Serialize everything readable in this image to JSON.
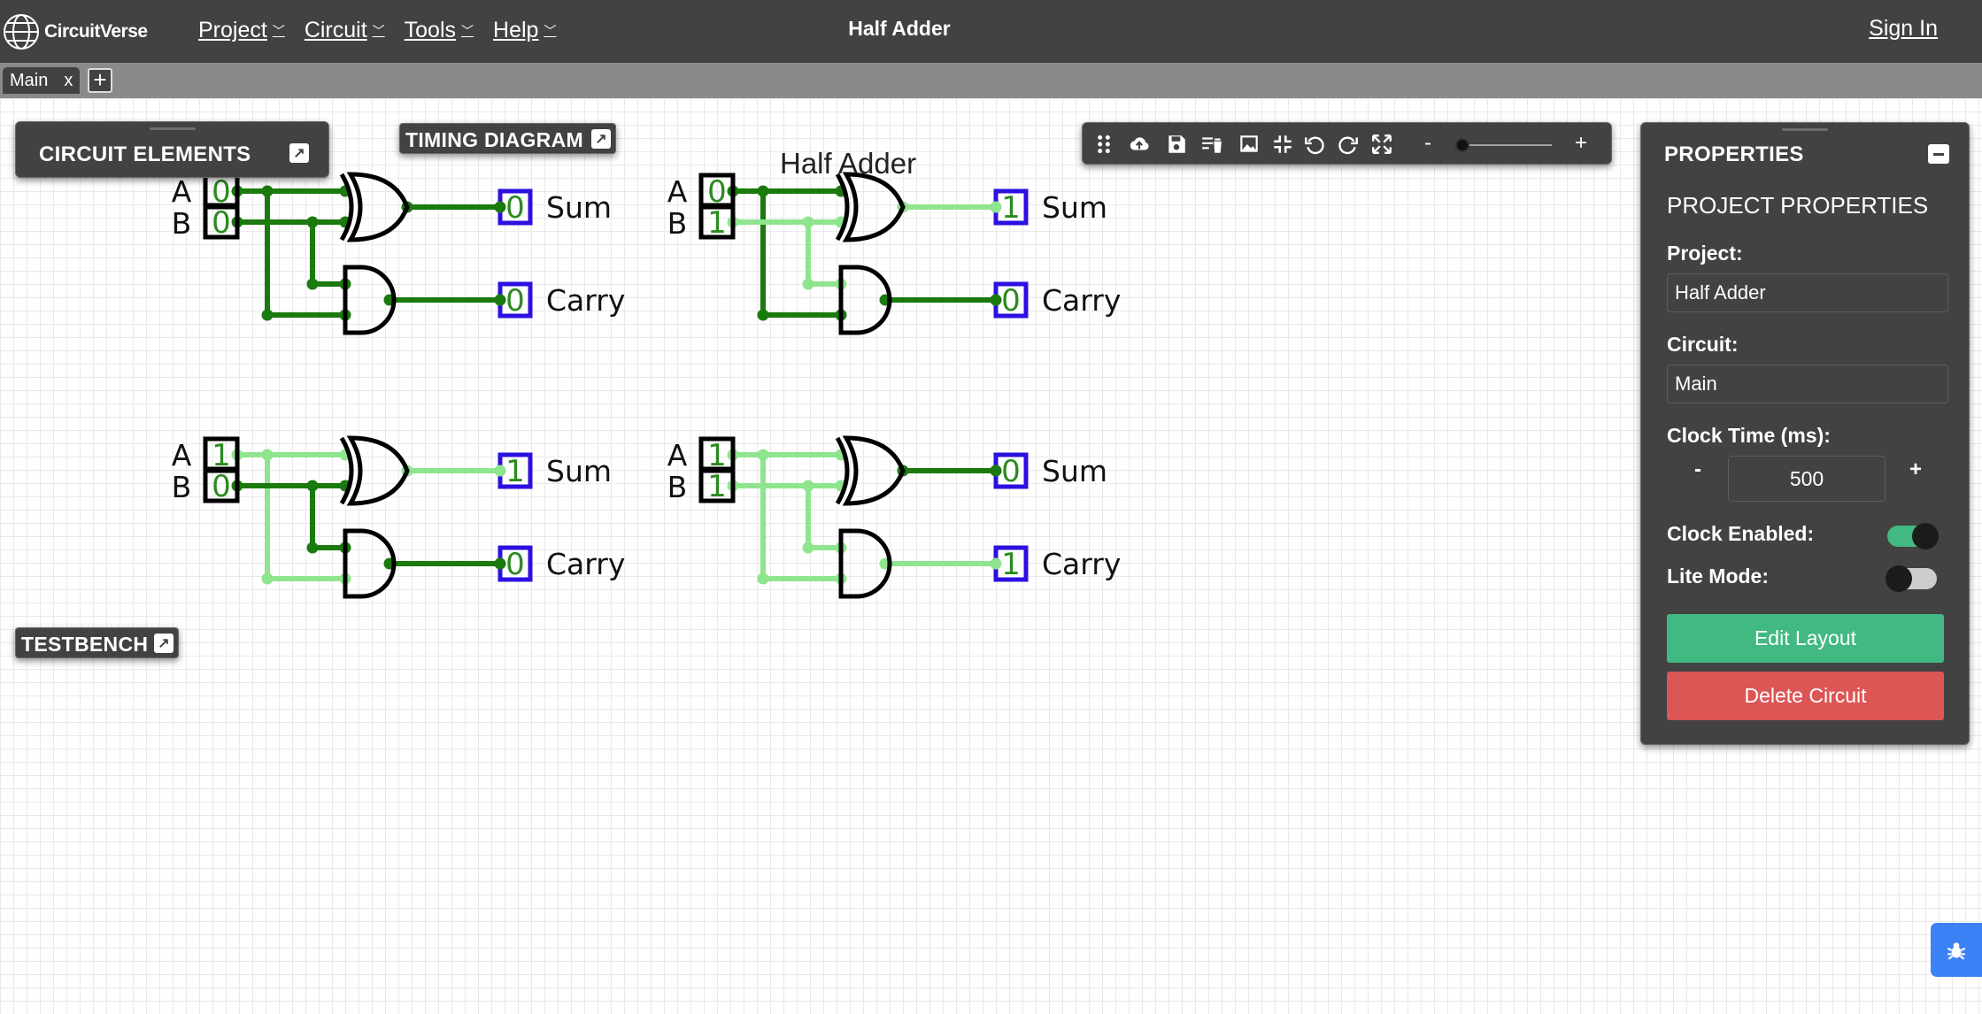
{
  "navbar": {
    "logo_text": "CircuitVerse",
    "menu": [
      {
        "label": "Project"
      },
      {
        "label": "Circuit"
      },
      {
        "label": "Tools"
      },
      {
        "label": "Help"
      }
    ],
    "title": "Half Adder",
    "signin": "Sign In"
  },
  "tabs": {
    "active_tab": "Main",
    "close_label": "x",
    "add_label": "+"
  },
  "panels": {
    "circuit_elements": "CIRCUIT ELEMENTS",
    "timing_diagram": "TIMING DIAGRAM",
    "testbench": "TESTBENCH"
  },
  "toolbar": {
    "icons": [
      "drag-handle-icon",
      "cloud-upload-icon",
      "save-icon",
      "clear-all-icon",
      "image-icon",
      "fit-screen-icon",
      "undo-icon",
      "redo-icon",
      "fullscreen-icon"
    ],
    "zoom_minus": "-",
    "zoom_plus": "+",
    "zoom_level": 0.05
  },
  "canvas": {
    "title": "Half Adder",
    "colors": {
      "wire_high": "#8ee58e",
      "wire_low": "#1a7a0e",
      "output_border": "#2b10e0",
      "value_text": "#2b8a1f"
    },
    "input_labels": {
      "a": "A",
      "b": "B"
    },
    "output_labels": {
      "sum": "Sum",
      "carry": "Carry"
    },
    "circuits": [
      {
        "a": "0",
        "b": "0",
        "sum": "0",
        "carry": "0"
      },
      {
        "a": "0",
        "b": "1",
        "sum": "1",
        "carry": "0"
      },
      {
        "a": "1",
        "b": "0",
        "sum": "1",
        "carry": "0"
      },
      {
        "a": "1",
        "b": "1",
        "sum": "0",
        "carry": "1"
      }
    ]
  },
  "properties": {
    "header": "PROPERTIES",
    "section_title": "PROJECT PROPERTIES",
    "project_label": "Project:",
    "project_value": "Half Adder",
    "circuit_label": "Circuit:",
    "circuit_value": "Main",
    "clock_time_label": "Clock Time (ms):",
    "clock_minus": "-",
    "clock_plus": "+",
    "clock_time_value": "500",
    "clock_enabled_label": "Clock Enabled:",
    "clock_enabled": true,
    "lite_mode_label": "Lite Mode:",
    "lite_mode": false,
    "edit_layout": "Edit Layout",
    "delete_circuit": "Delete Circuit"
  },
  "bug_report_icon": "bug-icon"
}
